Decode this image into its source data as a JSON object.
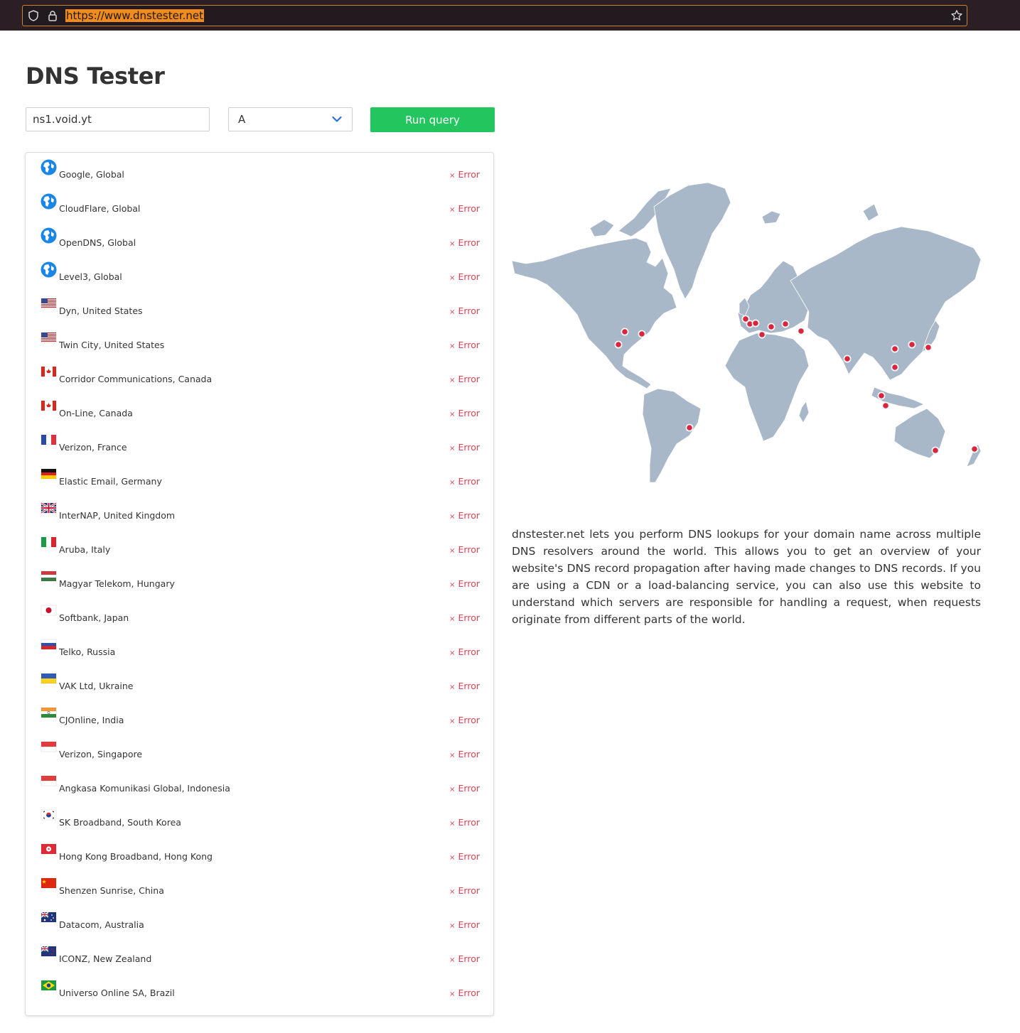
{
  "browser": {
    "url": "https://www.dnstester.net"
  },
  "page": {
    "title": "DNS Tester"
  },
  "form": {
    "domain_value": "ns1.void.yt",
    "record_type": "A",
    "run_label": "Run query"
  },
  "resolvers": [
    {
      "name": "Google, Global",
      "flag": "globe",
      "status": "Error"
    },
    {
      "name": "CloudFlare, Global",
      "flag": "globe",
      "status": "Error"
    },
    {
      "name": "OpenDNS, Global",
      "flag": "globe",
      "status": "Error"
    },
    {
      "name": "Level3, Global",
      "flag": "globe",
      "status": "Error"
    },
    {
      "name": "Dyn, United States",
      "flag": "us",
      "status": "Error"
    },
    {
      "name": "Twin City, United States",
      "flag": "us",
      "status": "Error"
    },
    {
      "name": "Corridor Communications, Canada",
      "flag": "ca",
      "status": "Error"
    },
    {
      "name": "On-Line, Canada",
      "flag": "ca",
      "status": "Error"
    },
    {
      "name": "Verizon, France",
      "flag": "fr",
      "status": "Error"
    },
    {
      "name": "Elastic Email, Germany",
      "flag": "de",
      "status": "Error"
    },
    {
      "name": "InterNAP, United Kingdom",
      "flag": "gb",
      "status": "Error"
    },
    {
      "name": "Aruba, Italy",
      "flag": "it",
      "status": "Error"
    },
    {
      "name": "Magyar Telekom, Hungary",
      "flag": "hu",
      "status": "Error"
    },
    {
      "name": "Softbank, Japan",
      "flag": "jp",
      "status": "Error"
    },
    {
      "name": "Telko, Russia",
      "flag": "ru",
      "status": "Error"
    },
    {
      "name": "VAK Ltd, Ukraine",
      "flag": "ua",
      "status": "Error"
    },
    {
      "name": "CJOnline, India",
      "flag": "in",
      "status": "Error"
    },
    {
      "name": "Verizon, Singapore",
      "flag": "sg",
      "status": "Error"
    },
    {
      "name": "Angkasa Komunikasi Global, Indonesia",
      "flag": "id",
      "status": "Error"
    },
    {
      "name": "SK Broadband, South Korea",
      "flag": "kr",
      "status": "Error"
    },
    {
      "name": "Hong Kong Broadband, Hong Kong",
      "flag": "hk",
      "status": "Error"
    },
    {
      "name": "Shenzen Sunrise, China",
      "flag": "cn",
      "status": "Error"
    },
    {
      "name": "Datacom, Australia",
      "flag": "au",
      "status": "Error"
    },
    {
      "name": "ICONZ, New Zealand",
      "flag": "nz",
      "status": "Error"
    },
    {
      "name": "Universo Online SA, Brazil",
      "flag": "br",
      "status": "Error"
    }
  ],
  "description": "dnstester.net lets you perform DNS lookups for your domain name across multiple DNS resolvers around the world. This allows you to get an overview of your website's DNS record propagation after having made changes to DNS records. If you are using a CDN or a load-balancing service, you can also use this website to understand which servers are responsible for handling a request, when requests originate from different parts of the world.",
  "colors": {
    "run_button": "#22c55e",
    "error": "#e0404f",
    "map_land": "#a8b8c8",
    "map_marker": "#d7263d"
  }
}
